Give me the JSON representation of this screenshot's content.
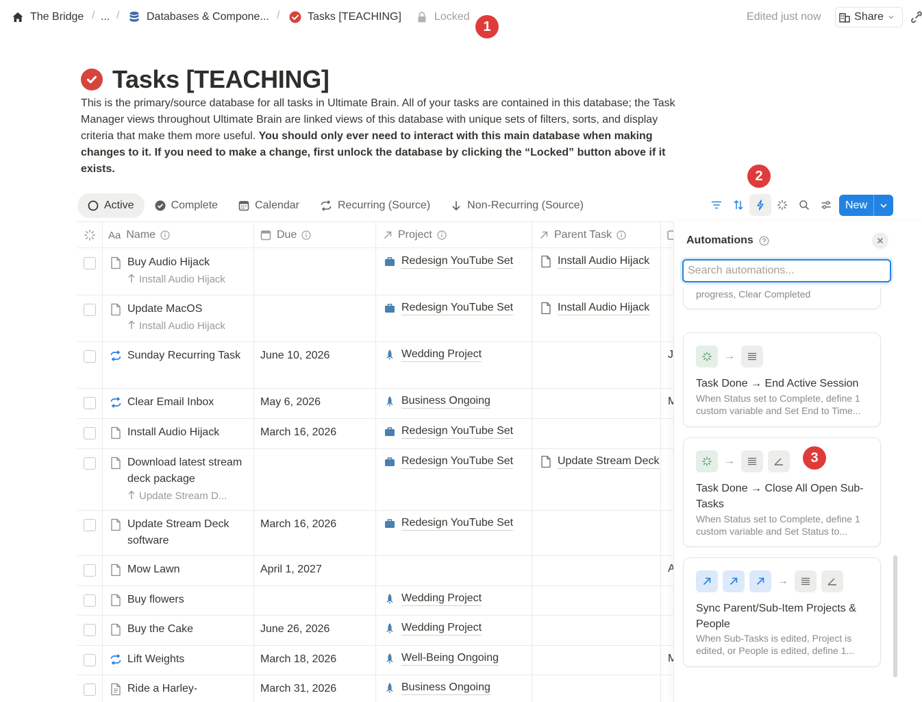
{
  "breadcrumb": {
    "workspace": "The Bridge",
    "ellipsis": "...",
    "parent": "Databases & Compone...",
    "current": "Tasks [TEACHING]",
    "lock_label": "Locked"
  },
  "header": {
    "edited": "Edited just now",
    "share_label": "Share"
  },
  "badges": [
    "1",
    "2",
    "3"
  ],
  "page": {
    "title": "Tasks [TEACHING]",
    "desc_plain": "This is the primary/source database for all tasks in Ultimate Brain. All of your tasks are contained in this database; the Task Manager views throughout Ultimate Brain are linked views of this database with unique sets of filters, sorts, and display criteria that make them more useful. ",
    "desc_bold": "You should only ever need to interact with this main database when making changes to it. If you need to make a change, first unlock the database by clicking the “Locked” button above if it exists."
  },
  "views": [
    {
      "label": "Active",
      "icon": "circle-icon"
    },
    {
      "label": "Complete",
      "icon": "check-circle-icon"
    },
    {
      "label": "Calendar",
      "icon": "calendar-icon"
    },
    {
      "label": "Recurring (Source)",
      "icon": "repeat-icon"
    },
    {
      "label": "Non-Recurring (Source)",
      "icon": "arrow-down-icon"
    }
  ],
  "toolbar": {
    "new_label": "New"
  },
  "columns": {
    "name": "Name",
    "name_prefix": "Aa",
    "due": "Due",
    "project": "Project",
    "parent": "Parent Task"
  },
  "rows": [
    {
      "name": "Buy Audio Hijack",
      "sub": "Install Audio Hijack",
      "due": "",
      "project": "Redesign YouTube Set",
      "project_icon": "briefcase",
      "parent": "Install Audio Hijack",
      "type": "doc",
      "extra": ""
    },
    {
      "name": "Update MacOS",
      "sub": "Install Audio Hijack",
      "due": "",
      "project": "Redesign YouTube Set",
      "project_icon": "briefcase",
      "parent": "Install Audio Hijack",
      "type": "doc",
      "extra": ""
    },
    {
      "name": "Sunday Recurring Task",
      "sub": "",
      "due": "June 10, 2026",
      "project": "Wedding Project",
      "project_icon": "rocket",
      "parent": "",
      "type": "repeat",
      "extra": "J"
    },
    {
      "name": "Clear Email Inbox",
      "sub": "",
      "due": "May 6, 2026",
      "project": "Business Ongoing",
      "project_icon": "rocket",
      "parent": "",
      "type": "repeat",
      "extra": "M"
    },
    {
      "name": "Install Audio Hijack",
      "sub": "",
      "due": "March 16, 2026",
      "project": "Redesign YouTube Set",
      "project_icon": "briefcase",
      "parent": "",
      "type": "doc",
      "extra": ""
    },
    {
      "name": "Download latest stream deck package",
      "sub": "Update Stream D...",
      "due": "",
      "project": "Redesign YouTube Set",
      "project_icon": "briefcase",
      "parent": "Update Stream Deck",
      "type": "doc",
      "extra": ""
    },
    {
      "name": "Update Stream Deck software",
      "sub": "",
      "due": "March 16, 2026",
      "project": "Redesign YouTube Set",
      "project_icon": "briefcase",
      "parent": "",
      "type": "doc",
      "extra": ""
    },
    {
      "name": "Mow Lawn",
      "sub": "",
      "due": "April 1, 2027",
      "project": "",
      "project_icon": "",
      "parent": "",
      "type": "doc",
      "extra": "A"
    },
    {
      "name": "Buy flowers",
      "sub": "",
      "due": "",
      "project": "Wedding Project",
      "project_icon": "rocket",
      "parent": "",
      "type": "doc",
      "extra": ""
    },
    {
      "name": "Buy the Cake",
      "sub": "",
      "due": "June 26, 2026",
      "project": "Wedding Project",
      "project_icon": "rocket",
      "parent": "",
      "type": "doc",
      "extra": ""
    },
    {
      "name": "Lift Weights",
      "sub": "",
      "due": "March 18, 2026",
      "project": "Well-Being Ongoing",
      "project_icon": "rocket",
      "parent": "",
      "type": "repeat",
      "extra": "M"
    },
    {
      "name": "Ride a Harley-",
      "sub": "",
      "due": "March 31, 2026",
      "project": "Business Ongoing",
      "project_icon": "rocket",
      "parent": "",
      "type": "doc-lines",
      "extra": ""
    }
  ],
  "automations": {
    "title": "Automations",
    "search_placeholder": "Search automations...",
    "partial_desc": "progress, Clear Completed",
    "cards": [
      {
        "title": "Task Done → End Active Session",
        "desc": "When Status set to Complete, define 1 custom variable and Set End to Time..."
      },
      {
        "title": "Task Done → Close All Open Sub-Tasks",
        "desc": "When Status set to Complete, define 1 custom variable and Set Status to..."
      },
      {
        "title": "Sync Parent/Sub-Item Projects & People",
        "desc": "When Sub-Tasks is edited, Project is edited, or People is edited, define 1..."
      }
    ]
  },
  "colors": {
    "accent": "#2383e2",
    "badge": "#e03b3b",
    "title_icon": "#d6453d",
    "project_icon": "#4a7fb0"
  }
}
